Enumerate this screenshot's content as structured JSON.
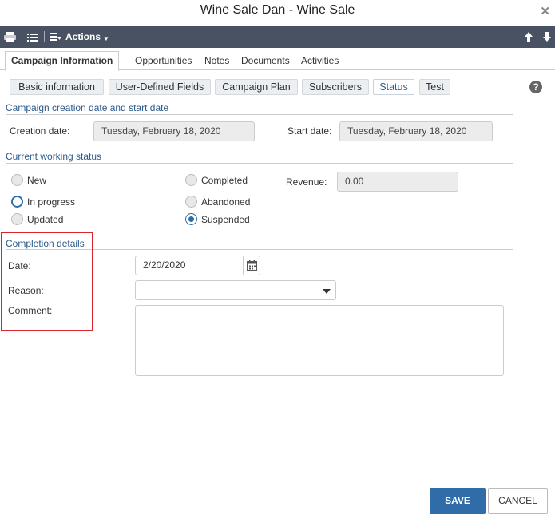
{
  "window": {
    "title": "Wine Sale Dan - Wine Sale"
  },
  "toolbar": {
    "actions_label": "Actions"
  },
  "tabs": [
    {
      "label": "Campaign Information"
    },
    {
      "label": "Opportunities"
    },
    {
      "label": "Notes"
    },
    {
      "label": "Documents"
    },
    {
      "label": "Activities"
    }
  ],
  "subtabs": [
    {
      "label": "Basic information"
    },
    {
      "label": "User-Defined Fields"
    },
    {
      "label": "Campaign Plan"
    },
    {
      "label": "Subscribers"
    },
    {
      "label": "Status"
    },
    {
      "label": "Test"
    }
  ],
  "dates_section": {
    "title": "Campaign creation date and start date",
    "creation_label": "Creation date:",
    "creation_value": "Tuesday, February 18, 2020",
    "start_label": "Start date:",
    "start_value": "Tuesday, February 18, 2020"
  },
  "status_section": {
    "title": "Current working status",
    "options": {
      "new": "New",
      "in_progress": "In progress",
      "updated": "Updated",
      "completed": "Completed",
      "abandoned": "Abandoned",
      "suspended": "Suspended"
    },
    "selected": "Suspended",
    "revenue_label": "Revenue:",
    "revenue_value": "0.00"
  },
  "completion_section": {
    "title": "Completion details",
    "date_label": "Date:",
    "date_value": "2/20/2020",
    "reason_label": "Reason:",
    "reason_value": "",
    "comment_label": "Comment:",
    "comment_value": ""
  },
  "buttons": {
    "save": "SAVE",
    "cancel": "CANCEL"
  },
  "colors": {
    "toolbar": "#495262",
    "accent": "#2f6ca8",
    "section_title": "#2c5a8c",
    "highlight": "#d7262d"
  }
}
